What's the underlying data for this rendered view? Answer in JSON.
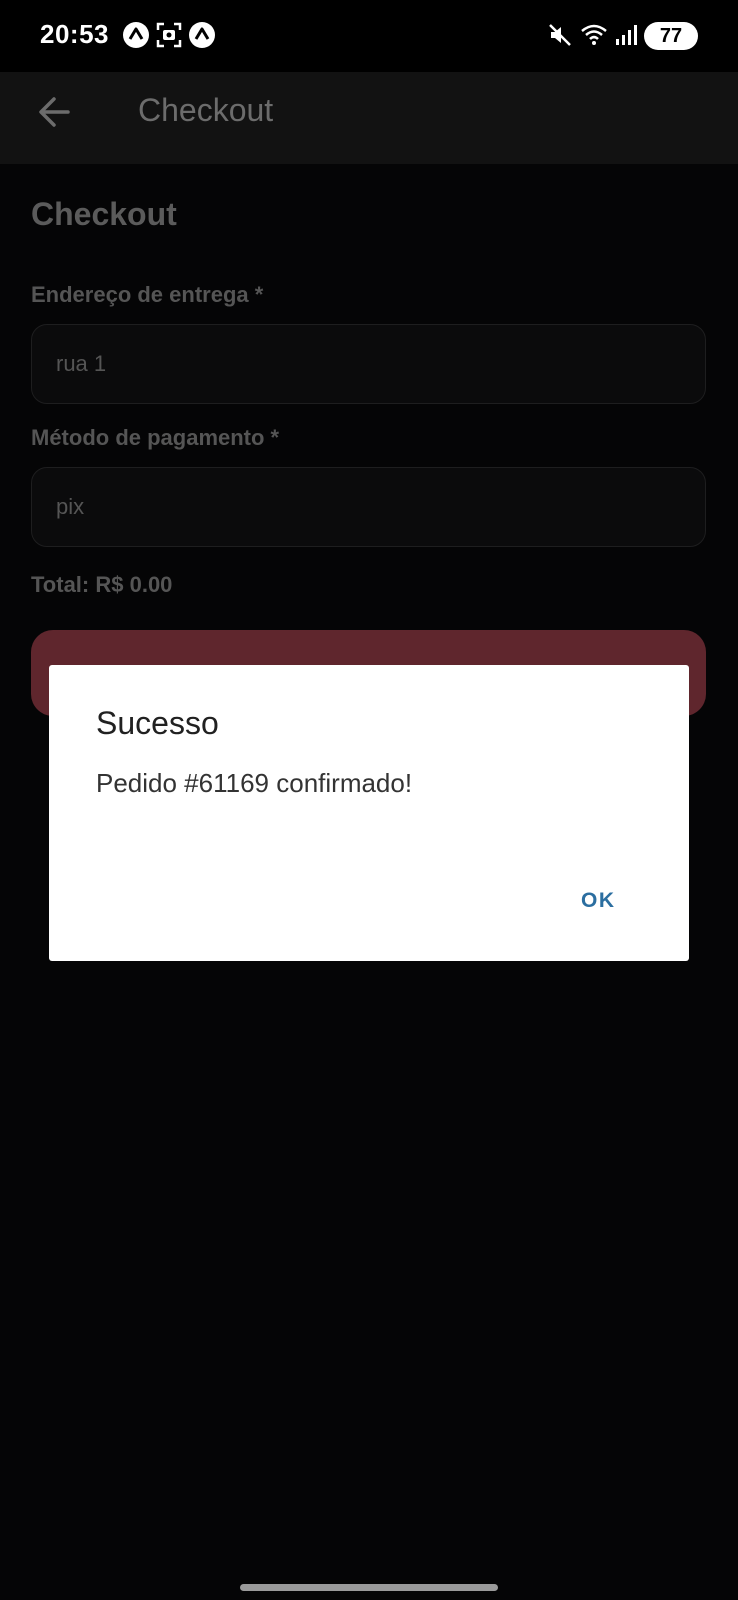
{
  "status_bar": {
    "time": "20:53",
    "battery_level": "77",
    "icons": [
      "app-notification-icon",
      "screenshot-icon",
      "app-notification-icon",
      "mute-icon",
      "wifi-icon",
      "signal-icon",
      "battery-icon"
    ]
  },
  "app_bar": {
    "title": "Checkout",
    "back_icon": "arrow-left-icon"
  },
  "form": {
    "heading": "Checkout",
    "address_label": "Endereço de entrega *",
    "address_value": "rua 1",
    "payment_label": "Método de pagamento *",
    "payment_value": "pix",
    "total_text": "Total: R$ 0.00"
  },
  "dialog": {
    "title": "Sucesso",
    "message": "Pedido #61169 confirmado!",
    "ok_label": "OK"
  },
  "colors": {
    "accent_button": "#5f262d",
    "dialog_action": "#2b6ea0",
    "background": "#050506"
  }
}
